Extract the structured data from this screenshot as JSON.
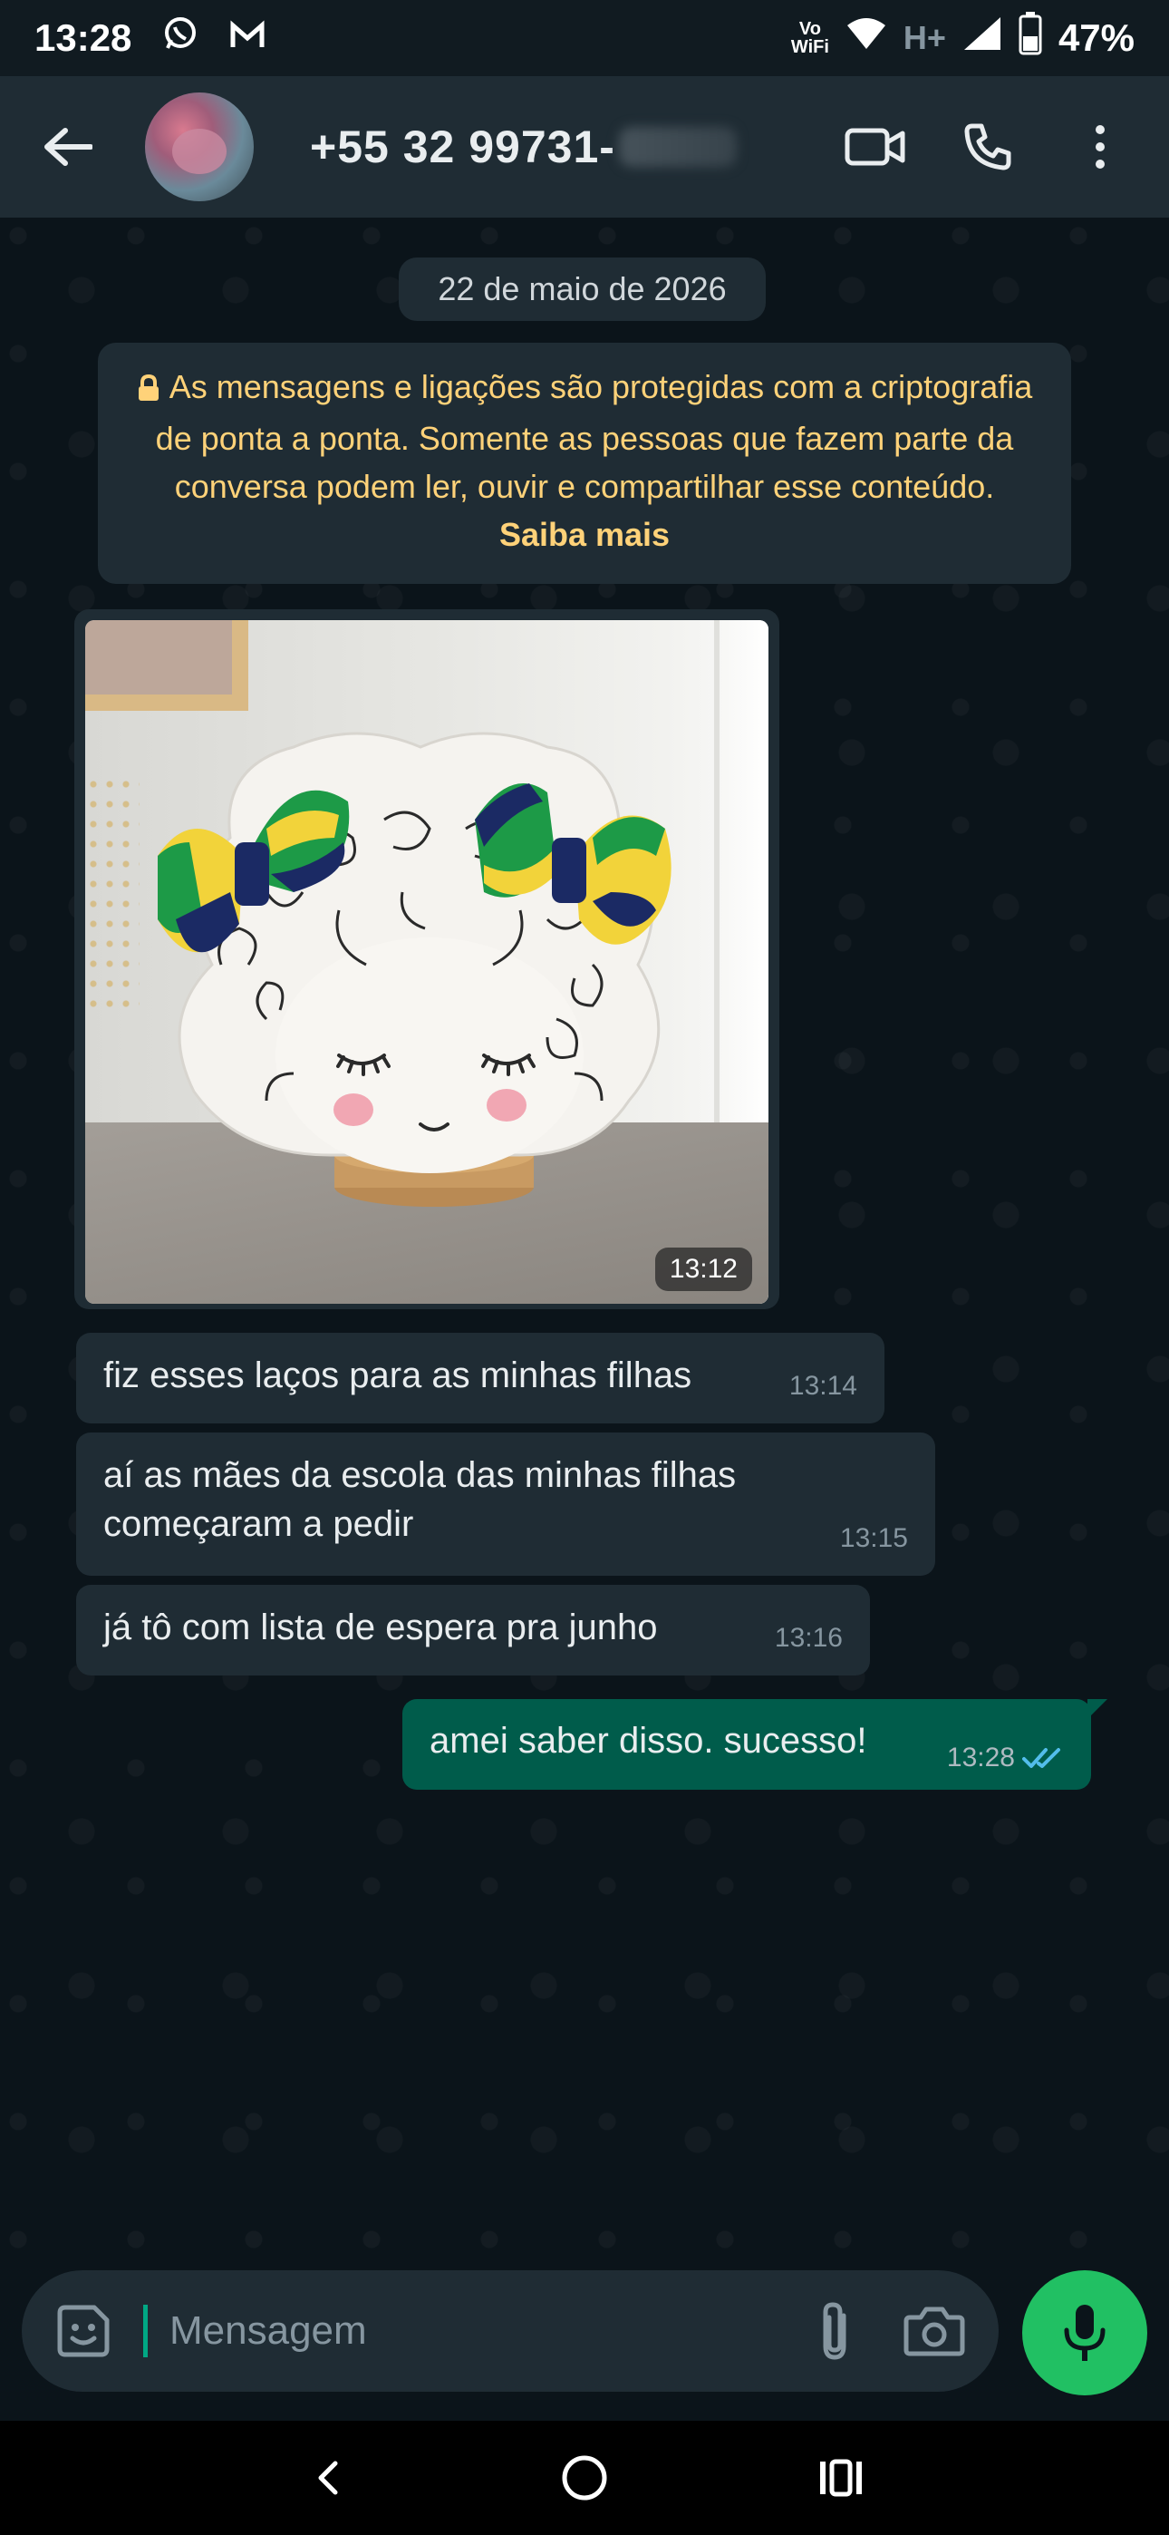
{
  "status_bar": {
    "time": "13:28",
    "vowifi_line1": "Vo",
    "vowifi_line2": "WiFi",
    "network": "H+",
    "battery": "47%",
    "icons": [
      "whatsapp-icon",
      "gmail-icon",
      "wifi-icon",
      "signal-icon",
      "battery-icon"
    ]
  },
  "header": {
    "contact_name": "+55 32 99731-",
    "icons": [
      "back-arrow-icon",
      "video-call-icon",
      "voice-call-icon",
      "more-options-icon"
    ]
  },
  "chat": {
    "date_chip": "22 de maio de 2026",
    "encryption_text": "As mensagens e ligações são protegidas com a criptografia de ponta a ponta. Somente as pessoas que fazem parte da conversa podem ler, ouvir e compartilhar esse conteúdo.",
    "encryption_link": "Saiba mais",
    "image_message_time": "13:12",
    "incoming": [
      {
        "text": "fiz esses laços para as minhas filhas",
        "time": "13:14"
      },
      {
        "text": "aí as mães da escola das minhas filhas começaram a pedir",
        "time": "13:15"
      },
      {
        "text": "já tô com lista de espera pra junho",
        "time": "13:16"
      }
    ],
    "outgoing": [
      {
        "text": "amei saber disso. sucesso!",
        "time": "13:28",
        "status": "read"
      }
    ]
  },
  "input": {
    "placeholder": "Mensagem",
    "value": ""
  },
  "colors": {
    "background": "#0b141a",
    "header": "#1f2c34",
    "incoming_bubble": "#1f2c34",
    "outgoing_bubble": "#005c4b",
    "accent_green": "#21c063",
    "encryption_text": "#ffd279",
    "read_ticks": "#53bdeb"
  }
}
